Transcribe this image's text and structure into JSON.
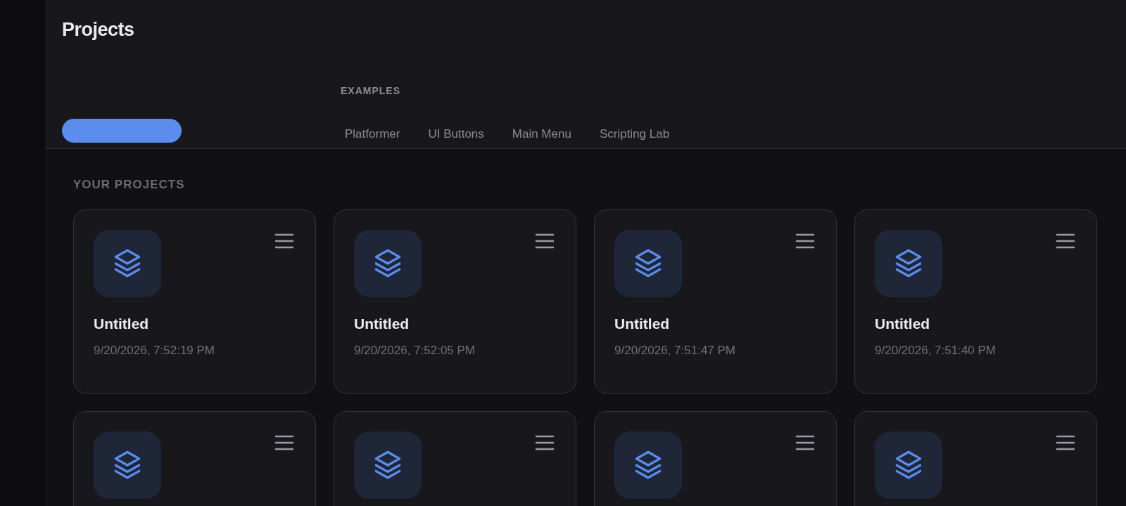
{
  "header": {
    "title": "Projects",
    "examples_label": "EXAMPLES",
    "examples": [
      {
        "label": "Platformer"
      },
      {
        "label": "UI Buttons"
      },
      {
        "label": "Main Menu"
      },
      {
        "label": "Scripting Lab"
      }
    ]
  },
  "projects_label": "YOUR PROJECTS",
  "projects": [
    {
      "kind": "full",
      "title": "Untitled",
      "date": "9/20/2026, 7:52:19 PM"
    },
    {
      "kind": "full",
      "title": "Untitled",
      "date": "9/20/2026, 7:52:05 PM"
    },
    {
      "kind": "full",
      "title": "Untitled",
      "date": "9/20/2026, 7:51:47 PM"
    },
    {
      "kind": "full",
      "title": "Untitled",
      "date": "9/20/2026, 7:51:40 PM"
    },
    {
      "kind": "partial"
    },
    {
      "kind": "partial"
    },
    {
      "kind": "partial"
    },
    {
      "kind": "partial"
    }
  ]
}
